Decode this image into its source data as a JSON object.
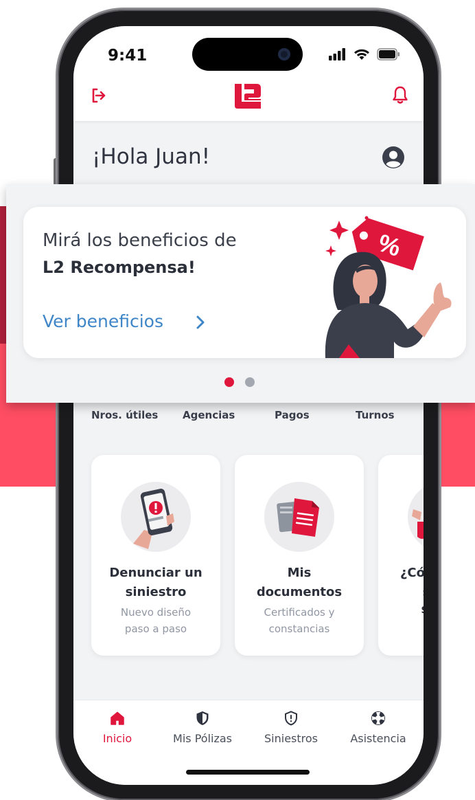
{
  "status_bar": {
    "time": "9:41"
  },
  "header": {
    "greeting": "¡Hola Juan!"
  },
  "banner": {
    "line1": "Mirá los beneficios de",
    "line2": "L2 Recompensa!",
    "link": "Ver beneficios",
    "slides": 2,
    "active_slide": 1,
    "badge_symbol": "%"
  },
  "quick_access": [
    "Nros. útiles",
    "Agencias",
    "Pagos",
    "Turnos"
  ],
  "cards": [
    {
      "title_line1": "Denunciar un",
      "title_line2": "siniestro",
      "sub_line1": "Nuevo diseño",
      "sub_line2": "paso a paso"
    },
    {
      "title_line1": "Mis",
      "title_line2": "documentos",
      "sub_line1": "Certificados y",
      "sub_line2": "constancias"
    },
    {
      "title_line1": "¿Có",
      "title_line2": "s",
      "sub_line1": "si",
      "sub_line2": ""
    }
  ],
  "tabs": [
    {
      "label": "Inicio",
      "icon": "home-icon",
      "active": true
    },
    {
      "label": "Mis Pólizas",
      "icon": "shield-icon",
      "active": false
    },
    {
      "label": "Siniestros",
      "icon": "alert-shield-icon",
      "active": false
    },
    {
      "label": "Asistencia",
      "icon": "lifebuoy-icon",
      "active": false
    }
  ],
  "colors": {
    "brand_red": "#e0173d",
    "link_blue": "#3e86c8",
    "background": "#f2f3f5"
  }
}
